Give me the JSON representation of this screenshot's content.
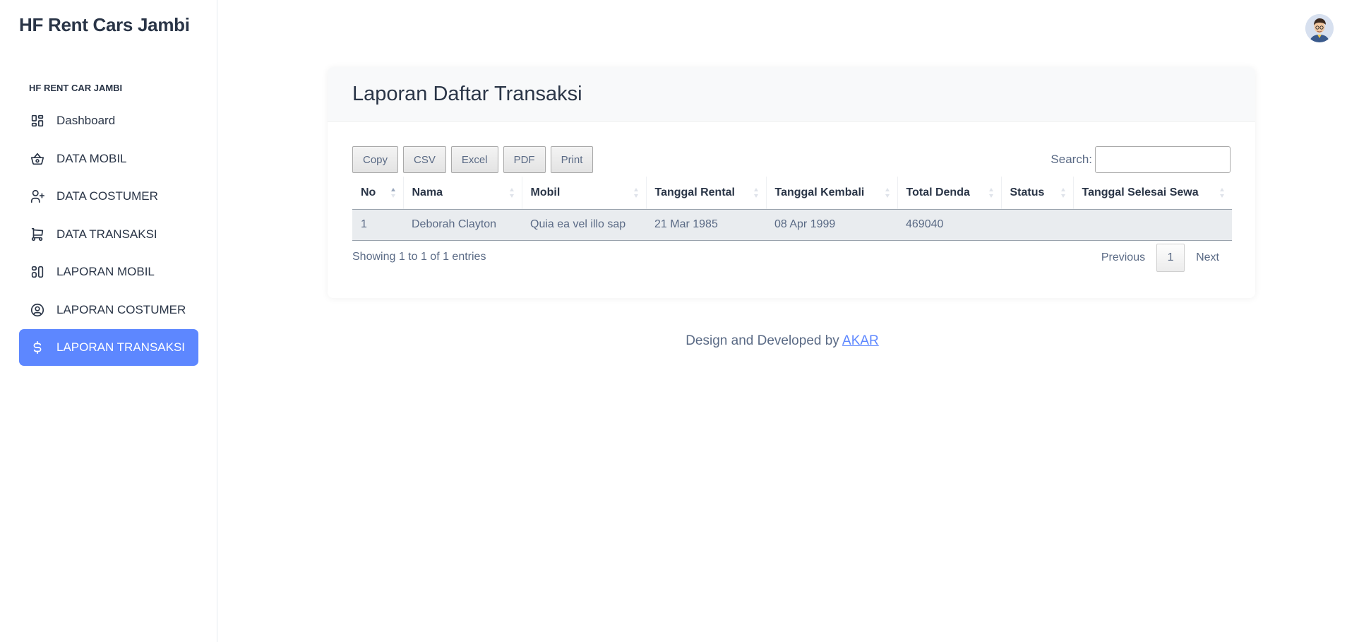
{
  "sidebar": {
    "brand": "HF Rent Cars Jambi",
    "caption": "HF RENT CAR JAMBI",
    "items": [
      {
        "label": "Dashboard",
        "icon": "dashboard-icon"
      },
      {
        "label": "DATA MOBIL",
        "icon": "basket-icon"
      },
      {
        "label": "DATA COSTUMER",
        "icon": "user-plus-icon"
      },
      {
        "label": "DATA TRANSAKSI",
        "icon": "cart-icon"
      },
      {
        "label": "LAPORAN MOBIL",
        "icon": "layout-icon"
      },
      {
        "label": "LAPORAN COSTUMER",
        "icon": "user-circle-icon"
      },
      {
        "label": "LAPORAN TRANSAKSI",
        "icon": "dollar-icon",
        "active": true
      }
    ]
  },
  "card": {
    "title": "Laporan Daftar Transaksi",
    "buttons": [
      "Copy",
      "CSV",
      "Excel",
      "PDF",
      "Print"
    ],
    "search_label": "Search:",
    "search_value": ""
  },
  "table": {
    "columns": [
      "No",
      "Nama",
      "Mobil",
      "Tanggal Rental",
      "Tanggal Kembali",
      "Total Denda",
      "Status",
      "Tanggal Selesai Sewa"
    ],
    "rows": [
      [
        "1",
        "Deborah Clayton",
        "Quia ea vel illo sap",
        "21 Mar 1985",
        "08 Apr 1999",
        "469040",
        "",
        ""
      ]
    ]
  },
  "pagination": {
    "info": "Showing 1 to 1 of 1 entries",
    "previous": "Previous",
    "current": "1",
    "next": "Next"
  },
  "footer": {
    "text": "Design and Developed by ",
    "link": "AKAR"
  },
  "colors": {
    "accent": "#5d87ff",
    "text": "#2a3547",
    "muted": "#5a6a85"
  }
}
